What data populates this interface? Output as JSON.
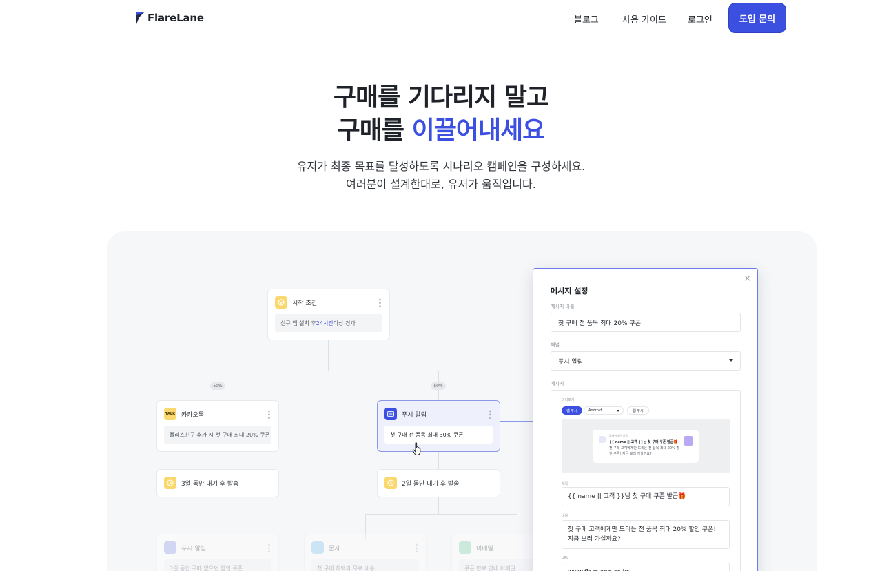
{
  "nav": {
    "logo": "FlareLane",
    "links": [
      "블로그",
      "사용 가이드",
      "로그인"
    ],
    "cta": "도입 문의",
    "brand_color": "#3b4fe0"
  },
  "hero": {
    "title_line1": "구매를 기다리지 말고",
    "title_line2_prefix": "구매를 ",
    "title_line2_accent": "이끌어내세요",
    "sub_line1": "유저가 최종 목표를 달성하도록 시나리오 캠페인을 구성하세요.",
    "sub_line2": "여러분이 설계한대로, 유저가 움직입니다."
  },
  "flow": {
    "start": {
      "title": "시작 조건",
      "body_prefix": "신규 앱 설치 후 ",
      "body_highlight": "24시간",
      "body_suffix": " 이상 경과",
      "icon": "check-circle-icon"
    },
    "split_left": "50%",
    "split_right": "50%",
    "kakao": {
      "title": "카카오톡",
      "icon_text": "TALK",
      "body": "플러스친구 추가 시 첫 구매 최대 20% 쿠폰"
    },
    "push": {
      "title": "푸시 알림",
      "body": "첫 구매 전 품목 최대 30% 쿠폰"
    },
    "wait_left": {
      "title": "3일 동안 대기 후 발송",
      "icon": "clock-icon"
    },
    "wait_right": {
      "title": "2일 동안 대기 후 발송",
      "icon": "clock-icon"
    },
    "bottom_push": {
      "title": "푸시 알림",
      "body": "3일 동안 구매 없으면 할인 쿠폰"
    },
    "bottom_sms": {
      "title": "문자",
      "body": "첫 구매 혜택과 무료 배송"
    },
    "bottom_email": {
      "title": "이메일",
      "body": "쿠폰 만료 안내 이메일"
    }
  },
  "modal": {
    "title": "메시지 설정",
    "close": "×",
    "name_label": "메시지 이름",
    "name_value": "첫 구매 전 품목 최대 20% 쿠폰",
    "channel_label": "채널",
    "channel_value": "푸시 알림",
    "message_label": "메시지",
    "preview_label": "미리보기",
    "tab_app_push": "앱 푸시",
    "os_select": "Android",
    "tab_web_push": "웹 푸시",
    "notif_app": "플레어레인 지금",
    "notif_title": "{{ name || 고객 }}님 첫 구매 쿠폰 발급🎁",
    "notif_body": "첫 구매 고객에게만 드리는 전 품목 최대 20% 할인 쿠폰! 지금 보러 가실까요?",
    "title_label": "제목",
    "title_value": "{{ name || 고객 }}님 첫 구매 쿠폰 발급🎁",
    "body_label": "내용",
    "body_value": "첫 구매 고객에게만 드리는 전 품목 최대 20% 할인 쿠폰! 지금 보러 가실까요?",
    "url_label": "URL",
    "url_value": "www.flarelane.co.kr"
  }
}
